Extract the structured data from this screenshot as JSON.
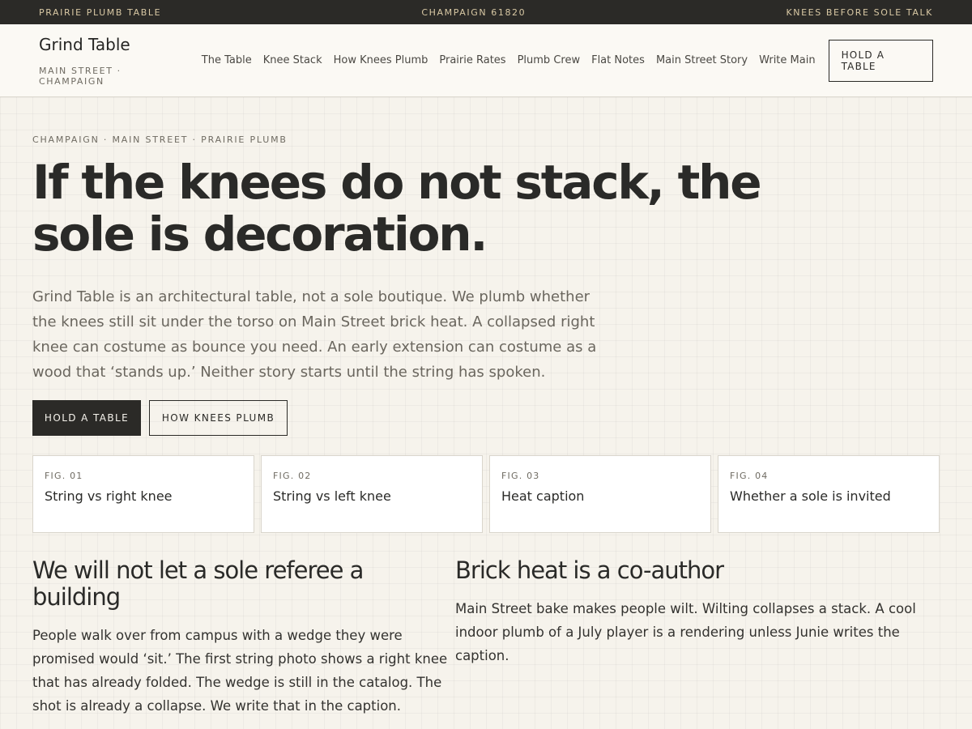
{
  "topbar": {
    "left": "PRAIRIE PLUMB TABLE",
    "center": "CHAMPAIGN 61820",
    "right": "KNEES BEFORE SOLE TALK"
  },
  "header": {
    "brand_name": "Grind Table",
    "brand_sub": "MAIN STREET · CHAMPAIGN",
    "nav": [
      {
        "label": "The Table"
      },
      {
        "label": "Knee Stack"
      },
      {
        "label": "How Knees Plumb"
      },
      {
        "label": "Prairie Rates"
      },
      {
        "label": "Plumb Crew"
      },
      {
        "label": "Flat Notes"
      },
      {
        "label": "Main Street Story"
      },
      {
        "label": "Write Main"
      }
    ],
    "cta": "HOLD A TABLE"
  },
  "hero": {
    "eyebrow": "CHAMPAIGN · MAIN STREET · PRAIRIE PLUMB",
    "title": "If the knees do not stack, the sole is decoration.",
    "lede": "Grind Table is an architectural table, not a sole boutique. We plumb whether the knees still sit under the torso on Main Street brick heat. A collapsed right knee can costume as bounce you need. An early extension can costume as a wood that ‘stands up.’ Neither story starts until the string has spoken.",
    "primary_button": "HOLD A TABLE",
    "secondary_button": "HOW KNEES PLUMB"
  },
  "figures": [
    {
      "num": "FIG. 01",
      "title": "String vs right knee"
    },
    {
      "num": "FIG. 02",
      "title": "String vs left knee"
    },
    {
      "num": "FIG. 03",
      "title": "Heat caption"
    },
    {
      "num": "FIG. 04",
      "title": "Whether a sole is invited"
    }
  ],
  "sections": {
    "left": {
      "title": "We will not let a sole referee a building",
      "body": "People walk over from campus with a wedge they were promised would ‘sit.’ The first string photo shows a right knee that has already folded. The wedge is still in the catalog. The shot is already a collapse. We write that in the caption."
    },
    "right": {
      "title": "Brick heat is a co-author",
      "body": "Main Street bake makes people wilt. Wilting collapses a stack. A cool indoor plumb of a July player is a rendering unless Junie writes the caption."
    }
  },
  "colors": {
    "ink": "#2b2a27",
    "background": "#f6f3ec",
    "accent_topbar_text": "#d8c8a4"
  }
}
